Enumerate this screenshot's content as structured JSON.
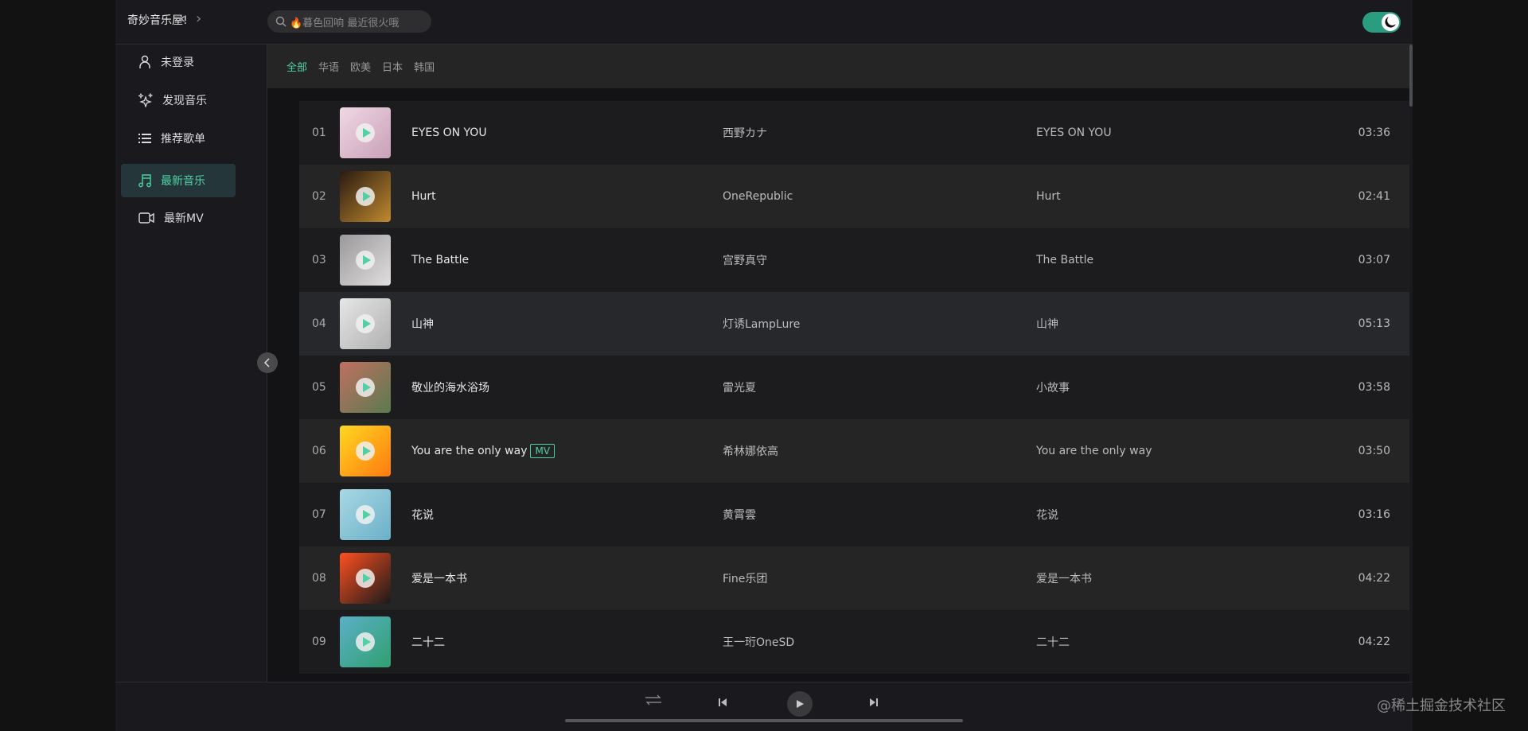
{
  "header": {
    "brand": "奇妙音乐屋!",
    "search_placeholder": "🔥暮色回响 最近很火哦",
    "dark_mode": true
  },
  "colors": {
    "accent": "#4fd1a5",
    "toggle": "#2a9d80"
  },
  "sidebar": {
    "items": [
      {
        "label": "未登录",
        "icon": "user-icon"
      },
      {
        "label": "发现音乐",
        "icon": "sparkle-icon"
      },
      {
        "label": "推荐歌单",
        "icon": "list-icon"
      },
      {
        "label": "最新音乐",
        "icon": "music-note-icon",
        "active": true
      },
      {
        "label": "最新MV",
        "icon": "video-icon"
      }
    ]
  },
  "filters": [
    {
      "label": "全部",
      "active": true
    },
    {
      "label": "华语"
    },
    {
      "label": "欧美"
    },
    {
      "label": "日本"
    },
    {
      "label": "韩国"
    }
  ],
  "songs": [
    {
      "num": "01",
      "title": "EYES ON YOU",
      "artist": "西野カナ",
      "album": "EYES ON YOU",
      "duration": "03:36",
      "cover": [
        "#f0d8e4",
        "#c9a0b8"
      ]
    },
    {
      "num": "02",
      "title": "Hurt",
      "artist": "OneRepublic",
      "album": "Hurt",
      "duration": "02:41",
      "cover": [
        "#2a1a10",
        "#c08a30"
      ]
    },
    {
      "num": "03",
      "title": "The Battle",
      "artist": "宫野真守",
      "album": "The Battle",
      "duration": "03:07",
      "cover": [
        "#9a9898",
        "#e0dede"
      ]
    },
    {
      "num": "04",
      "title": "山神",
      "artist": "灯诱LampLure",
      "album": "山神",
      "duration": "05:13",
      "cover": [
        "#e6e6e6",
        "#b0b0b0"
      ]
    },
    {
      "num": "05",
      "title": "敬业的海水浴场",
      "artist": "雷光夏",
      "album": "小故事",
      "duration": "03:58",
      "cover": [
        "#c07060",
        "#5a7a50"
      ]
    },
    {
      "num": "06",
      "title": "You are the only way",
      "mv": "MV",
      "artist": "希林娜依高",
      "album": "You are the only way",
      "duration": "03:50",
      "cover": [
        "#ffd820",
        "#ff7a10"
      ]
    },
    {
      "num": "07",
      "title": "花说",
      "artist": "黄霄雲",
      "album": "花说",
      "duration": "03:16",
      "cover": [
        "#a8d8e4",
        "#6ab0c8"
      ]
    },
    {
      "num": "08",
      "title": "爱是一本书",
      "artist": "Fine乐团",
      "album": "爱是一本书",
      "duration": "04:22",
      "cover": [
        "#ff5020",
        "#1a1a1a"
      ]
    },
    {
      "num": "09",
      "title": "二十二",
      "artist": "王一珩OneSD",
      "album": "二十二",
      "duration": "04:22",
      "cover": [
        "#5ab0c8",
        "#30a070"
      ]
    }
  ],
  "player": {
    "progress": 0.0
  },
  "watermark": "@稀土掘金技术社区"
}
